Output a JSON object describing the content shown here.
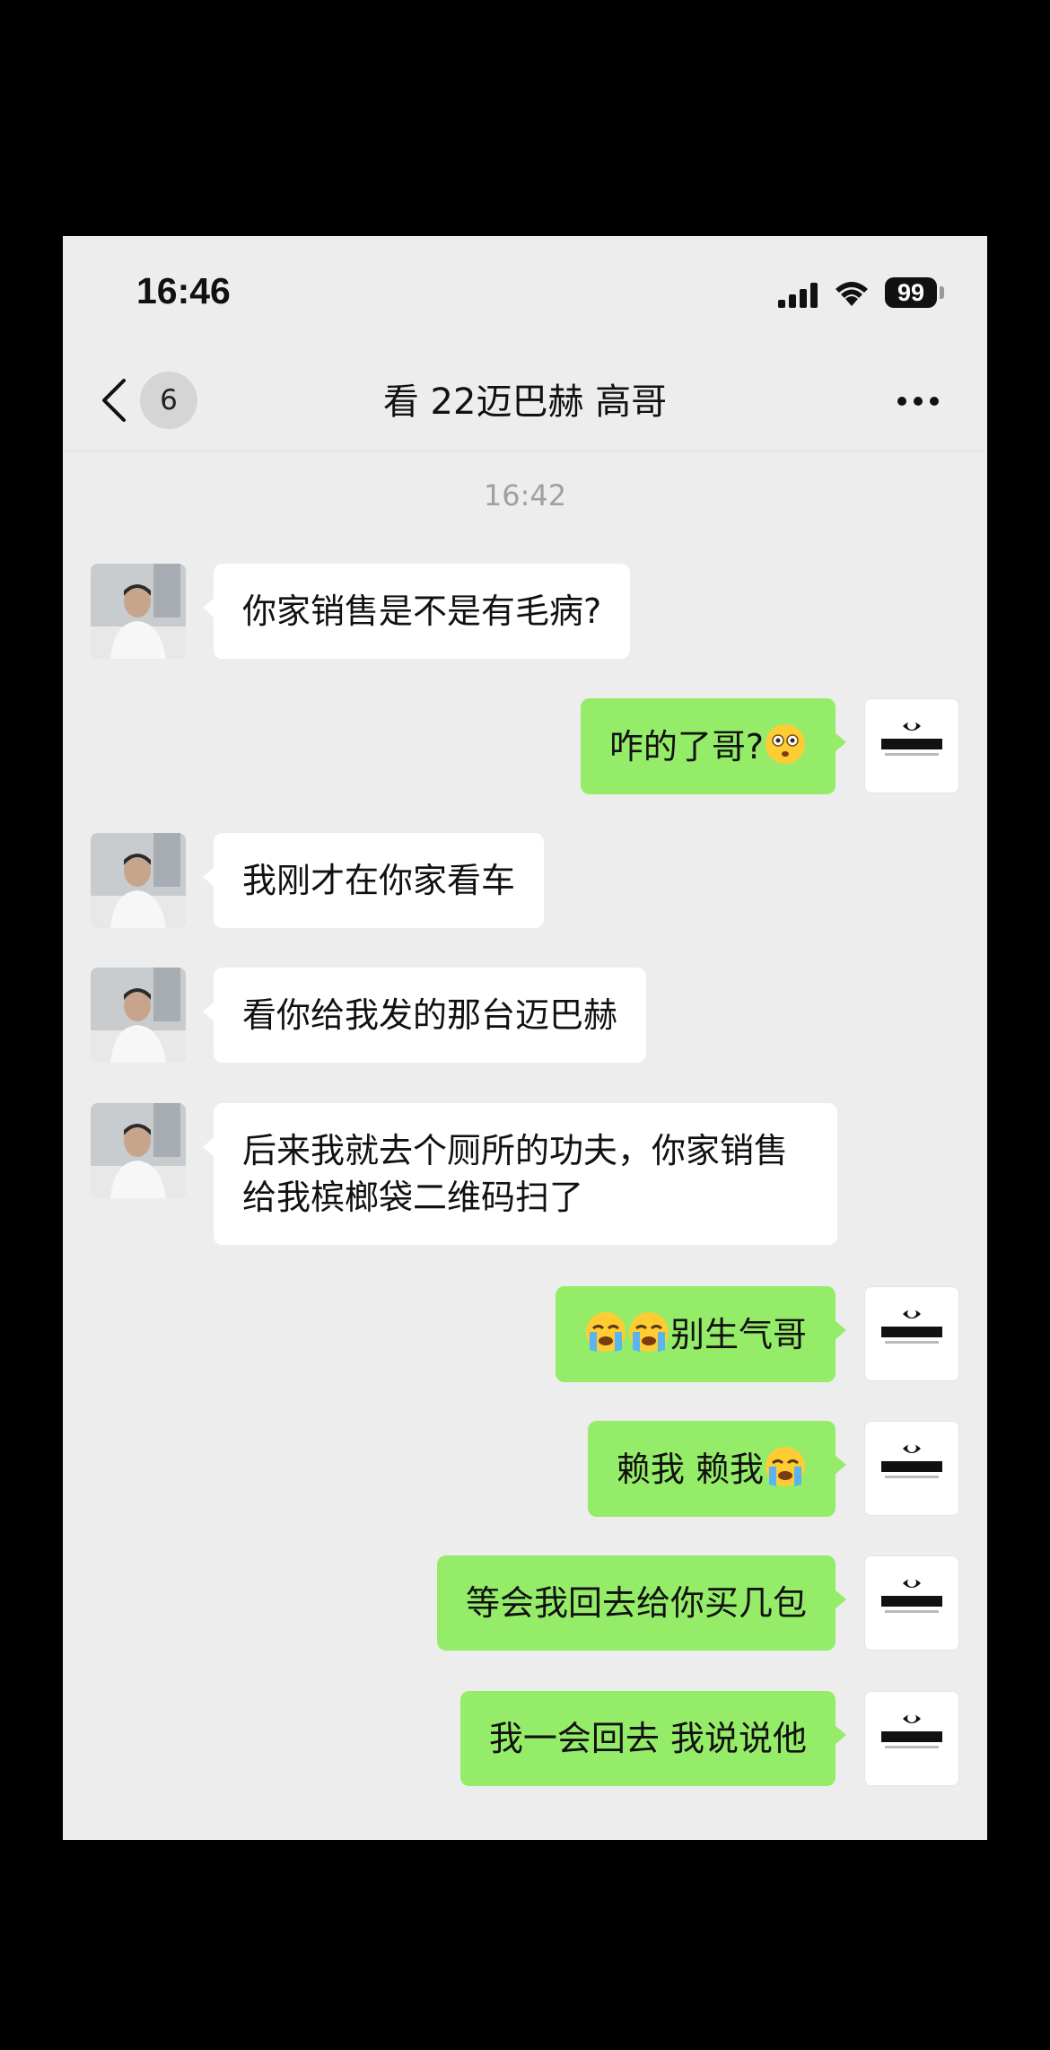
{
  "status_bar": {
    "time": "16:46",
    "battery": "99"
  },
  "nav": {
    "unread_count": "6",
    "title": "看 22迈巴赫 高哥"
  },
  "chat": {
    "timestamp": "16:42",
    "messages": [
      {
        "side": "left",
        "text": "你家销售是不是有毛病?"
      },
      {
        "side": "right",
        "text": "咋的了哥?",
        "emoji_after": "astonished-face-icon"
      },
      {
        "side": "left",
        "text": "我刚才在你家看车"
      },
      {
        "side": "left",
        "text": "看你给我发的那台迈巴赫"
      },
      {
        "side": "left",
        "text": "后来我就去个厕所的功夫，你家销售给我槟榔袋二维码扫了"
      },
      {
        "side": "right",
        "text": "别生气哥",
        "emoji_before": "loudly-crying-face-icon x2"
      },
      {
        "side": "right",
        "text": "赖我 赖我",
        "emoji_after": "loudly-crying-face-icon"
      },
      {
        "side": "right",
        "text": "等会我回去给你买几包"
      },
      {
        "side": "right",
        "text": "我一会回去 我说说他"
      }
    ]
  },
  "colors": {
    "background": "#ededed",
    "bubble_sent": "#95ec69",
    "bubble_received": "#ffffff",
    "page_border": "#000000"
  }
}
